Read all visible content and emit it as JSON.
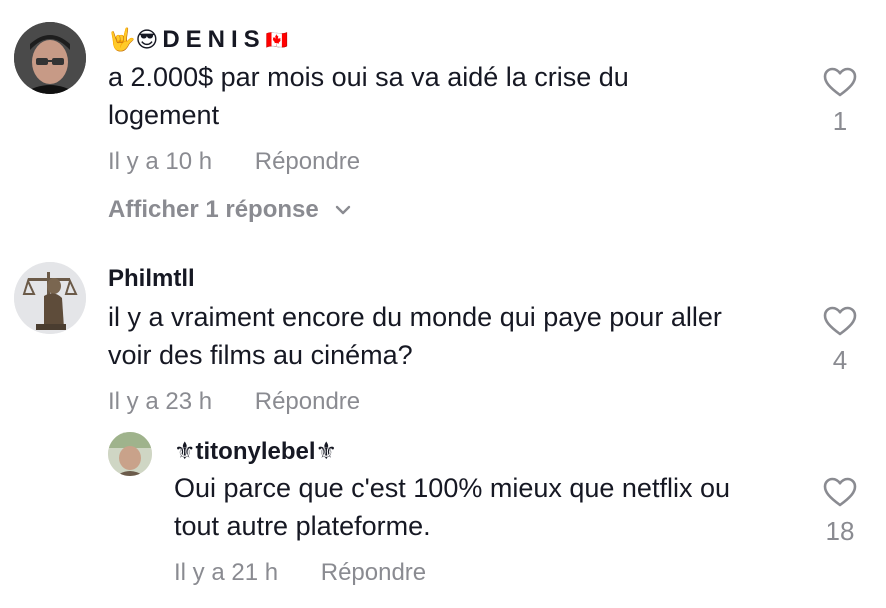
{
  "comments": [
    {
      "username_prefix": "🤟😎",
      "username": "DENIS",
      "username_suffix": "🇨🇦",
      "text_line1": "a 2.000$ par mois oui sa va aidé la crise du",
      "text_line2": "logement",
      "time": "Il y a 10 h",
      "reply_label": "Répondre",
      "likes": "1",
      "view_replies": "Afficher 1 réponse"
    },
    {
      "username": "Philmtll",
      "text_line1": "il y a vraiment encore du monde qui paye pour aller",
      "text_line2": "voir des films au cinéma?",
      "time": "Il y a 23 h",
      "reply_label": "Répondre",
      "likes": "4"
    },
    {
      "username": "⚜titonylebel⚜",
      "text_line1": "Oui parce que c'est 100% mieux que netflix ou",
      "text_line2": "tout autre plateforme.",
      "time": "Il y a 21 h",
      "reply_label": "Répondre",
      "likes": "18"
    }
  ]
}
